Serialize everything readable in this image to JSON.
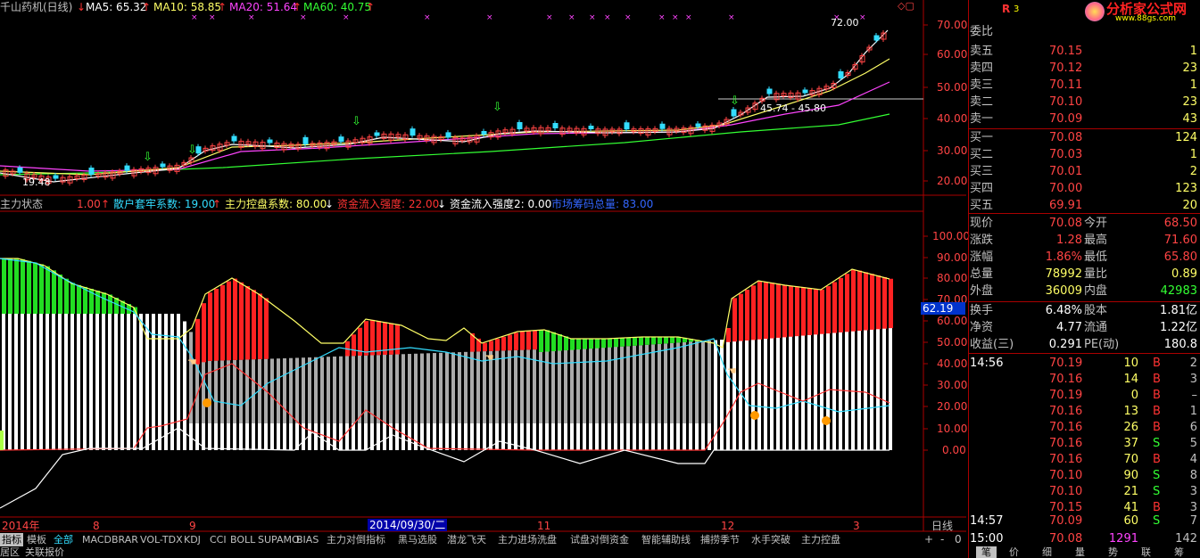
{
  "header": {
    "title": "千山药机(日线)",
    "ma": [
      {
        "label": "MA5: 65.32",
        "color": "#ffffff"
      },
      {
        "label": "MA10: 58.85",
        "color": "#ffff66"
      },
      {
        "label": "MA20: 51.64",
        "color": "#ff44ff"
      },
      {
        "label": "MA60: 40.75",
        "color": "#33ff33"
      }
    ]
  },
  "price_chart": {
    "y_ticks": [
      "70.00",
      "60.00",
      "50.00",
      "40.00",
      "30.00",
      "20.00"
    ],
    "annotations": {
      "high": "72.00",
      "range": "45.74 - 45.80",
      "low": "19.48"
    }
  },
  "indicator": {
    "name": "主力状态",
    "items": [
      {
        "label": "1.00",
        "color": "#ff4444"
      },
      {
        "label": "散户套牢系数: 19.00",
        "color": "#33ddff"
      },
      {
        "label": "主力控盘系数: 80.00",
        "color": "#ffff66"
      },
      {
        "label": "资金流入强度: 22.00",
        "color": "#ff3333"
      },
      {
        "label": "资金流入强度2: 0.00",
        "color": "#ffffff"
      },
      {
        "label": "市场筹码总量: 83.00",
        "color": "#3366ff"
      }
    ],
    "y_ticks": [
      "100.00",
      "90.00",
      "80.00",
      "70.00",
      "60.00",
      "50.00",
      "40.00",
      "30.00",
      "20.00",
      "10.00",
      "0.00"
    ],
    "cursor_value": "62.19"
  },
  "time_axis": {
    "labels": [
      "2014年",
      "8",
      "9",
      "11",
      "12",
      "3"
    ],
    "highlight": "2014/09/30/二",
    "period": "日线"
  },
  "tabs": [
    "指标",
    "模板",
    "全部",
    "MACD",
    "BRAR",
    "VOL-TDX",
    "KDJ",
    "CCI",
    "BOLL",
    "SUPAMO",
    "BIAS",
    "主力对倒指标",
    "黑马选股",
    "潜龙飞天",
    "主力进场洗盘",
    "试盘对倒资金",
    "智能辅助线",
    "捕捞季节",
    "水手突破",
    "主力控盘"
  ],
  "controls": [
    "+",
    "-",
    "0"
  ],
  "bottom_bar": [
    "居区",
    "关联报价"
  ],
  "right_tabs": [
    "笔",
    "价",
    "细",
    "量",
    "势",
    "联",
    "筹"
  ],
  "quote": {
    "logo": "分析家公式网",
    "logo_url": "www.88gs.com",
    "badge_r": "R",
    "badge_3": "3",
    "weibi": "委比",
    "sell": [
      {
        "label": "卖五",
        "price": "70.15",
        "vol": "1"
      },
      {
        "label": "卖四",
        "price": "70.12",
        "vol": "23"
      },
      {
        "label": "卖三",
        "price": "70.11",
        "vol": "1"
      },
      {
        "label": "卖二",
        "price": "70.10",
        "vol": "23"
      },
      {
        "label": "卖一",
        "price": "70.09",
        "vol": "43"
      }
    ],
    "buy": [
      {
        "label": "买一",
        "price": "70.08",
        "vol": "124"
      },
      {
        "label": "买二",
        "price": "70.03",
        "vol": "1"
      },
      {
        "label": "买三",
        "price": "70.01",
        "vol": "2"
      },
      {
        "label": "买四",
        "price": "70.00",
        "vol": "123"
      },
      {
        "label": "买五",
        "price": "69.91",
        "vol": "20"
      }
    ],
    "stats": [
      {
        "l1": "现价",
        "v1": "70.08",
        "l2": "今开",
        "v2": "68.50"
      },
      {
        "l1": "涨跌",
        "v1": "1.28",
        "l2": "最高",
        "v2": "71.60"
      },
      {
        "l1": "涨幅",
        "v1": "1.86%",
        "l2": "最低",
        "v2": "65.80"
      },
      {
        "l1": "总量",
        "v1": "78992",
        "l2": "量比",
        "v2": "0.89"
      },
      {
        "l1": "外盘",
        "v1": "36009",
        "l2": "内盘",
        "v2": "42983"
      }
    ],
    "stats2": [
      {
        "l1": "换手",
        "v1": "6.48%",
        "l2": "股本",
        "v2": "1.81亿"
      },
      {
        "l1": "净资",
        "v1": "4.77",
        "l2": "流通",
        "v2": "1.22亿"
      },
      {
        "l1": "收益(三)",
        "v1": "0.291",
        "l2": "PE(动)",
        "v2": "180.8"
      }
    ],
    "ticks": [
      {
        "time": "14:56",
        "price": "70.19",
        "vol": "10",
        "bs": "B",
        "n": "2"
      },
      {
        "time": "",
        "price": "70.16",
        "vol": "14",
        "bs": "B",
        "n": "3"
      },
      {
        "time": "",
        "price": "70.19",
        "vol": "0",
        "bs": "B",
        "n": "–"
      },
      {
        "time": "",
        "price": "70.16",
        "vol": "13",
        "bs": "B",
        "n": "1"
      },
      {
        "time": "",
        "price": "70.16",
        "vol": "26",
        "bs": "B",
        "n": "6"
      },
      {
        "time": "",
        "price": "70.16",
        "vol": "37",
        "bs": "S",
        "n": "5"
      },
      {
        "time": "",
        "price": "70.16",
        "vol": "70",
        "bs": "B",
        "n": "4"
      },
      {
        "time": "",
        "price": "70.10",
        "vol": "90",
        "bs": "S",
        "n": "8"
      },
      {
        "time": "",
        "price": "70.10",
        "vol": "21",
        "bs": "S",
        "n": "3"
      },
      {
        "time": "",
        "price": "70.15",
        "vol": "41",
        "bs": "B",
        "n": "3"
      },
      {
        "time": "14:57",
        "price": "70.09",
        "vol": "60",
        "bs": "S",
        "n": "7"
      },
      {
        "time": "15:00",
        "price": "70.08",
        "vol": "1291",
        "bs": "",
        "n": "142"
      }
    ]
  }
}
